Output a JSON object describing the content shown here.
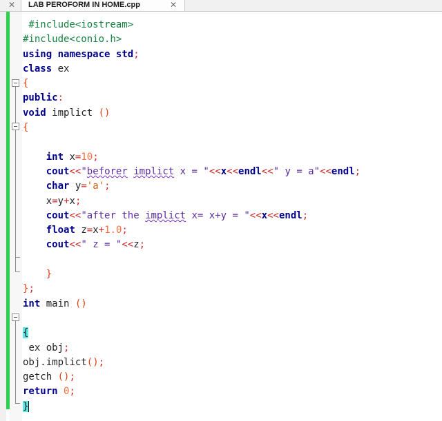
{
  "tabs": [
    {
      "title": "LAB PEROFORM IN HOME.cpp",
      "active": true
    }
  ],
  "editor": {
    "filename": "LAB PEROFORM IN HOME.cpp",
    "language": "cpp",
    "lines": [
      " #include<iostream>",
      "#include<conio.h>",
      "using namespace std;",
      "class ex",
      "{",
      "public:",
      "void implict ()",
      "{",
      "",
      "    int x=10;",
      "    cout<<\"beforer implict x = \"<<x<<endl<<\" y = a\"<<endl;",
      "    char y='a';",
      "    x=y+x;",
      "    cout<<\"after the implict x= x+y = \"<<x<<endl;",
      "    float z=x+1.0;",
      "    cout<<\" z = \"<<z;",
      "",
      "    }",
      "};",
      "int main ()",
      "",
      "{",
      " ex obj;",
      "obj.implict();",
      "getch ();",
      "return 0;",
      "}"
    ]
  },
  "colors": {
    "change_bar": "#2bd34b",
    "keyword": "#00008b",
    "preprocessor": "#158040",
    "number": "#ff6f3c",
    "string": "#5a2da0",
    "operator": "#cc2a2a",
    "brace_match_highlight": "#5ee6e6"
  },
  "icons": {
    "tab_close": "close-icon",
    "fold": "fold-collapse-icon"
  }
}
